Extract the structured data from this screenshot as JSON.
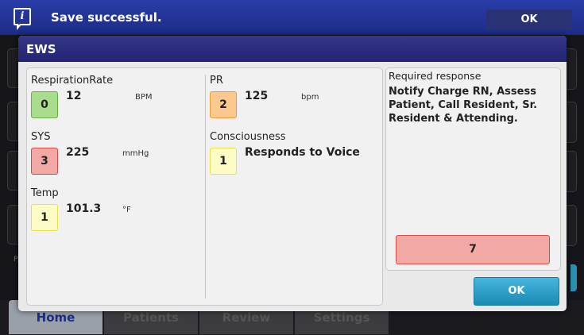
{
  "banner": {
    "message": "Save successful.",
    "ok_label": "OK",
    "icon": "info-icon"
  },
  "background": {
    "ghost_label": "P/"
  },
  "tabs": [
    {
      "label": "Home",
      "active": true
    },
    {
      "label": "Patients",
      "active": false
    },
    {
      "label": "Review",
      "active": false
    },
    {
      "label": "Settings",
      "active": false
    }
  ],
  "dialog": {
    "title": "EWS",
    "params": {
      "resp_rate": {
        "label": "RespirationRate",
        "score": "0",
        "value": "12",
        "unit": "BPM",
        "color": "#a9dc8c",
        "border": "#6cae46"
      },
      "sys": {
        "label": "SYS",
        "score": "3",
        "value": "225",
        "unit": "mmHg",
        "color": "#f2a9a6",
        "border": "#d24c48"
      },
      "temp": {
        "label": "Temp",
        "score": "1",
        "value": "101.3",
        "unit": "°F",
        "color": "#fdfcc6",
        "border": "#e6e14a"
      },
      "pr": {
        "label": "PR",
        "score": "2",
        "value": "125",
        "unit": "bpm",
        "color": "#fbc98d",
        "border": "#e89b3c"
      },
      "consciousness": {
        "label": "Consciousness",
        "score": "1",
        "value": "Responds to Voice",
        "color": "#fdfcc6",
        "border": "#e6e14a"
      }
    },
    "required_response": {
      "label": "Required response",
      "text": "Notify Charge RN, Assess Patient, Call Resident, Sr. Resident & Attending."
    },
    "total_score": "7",
    "ok_label": "OK"
  },
  "colors": {
    "header_blue": "#2a3da8",
    "ok_teal": "#2a9cc7",
    "total_red": "#f2a9a6"
  }
}
